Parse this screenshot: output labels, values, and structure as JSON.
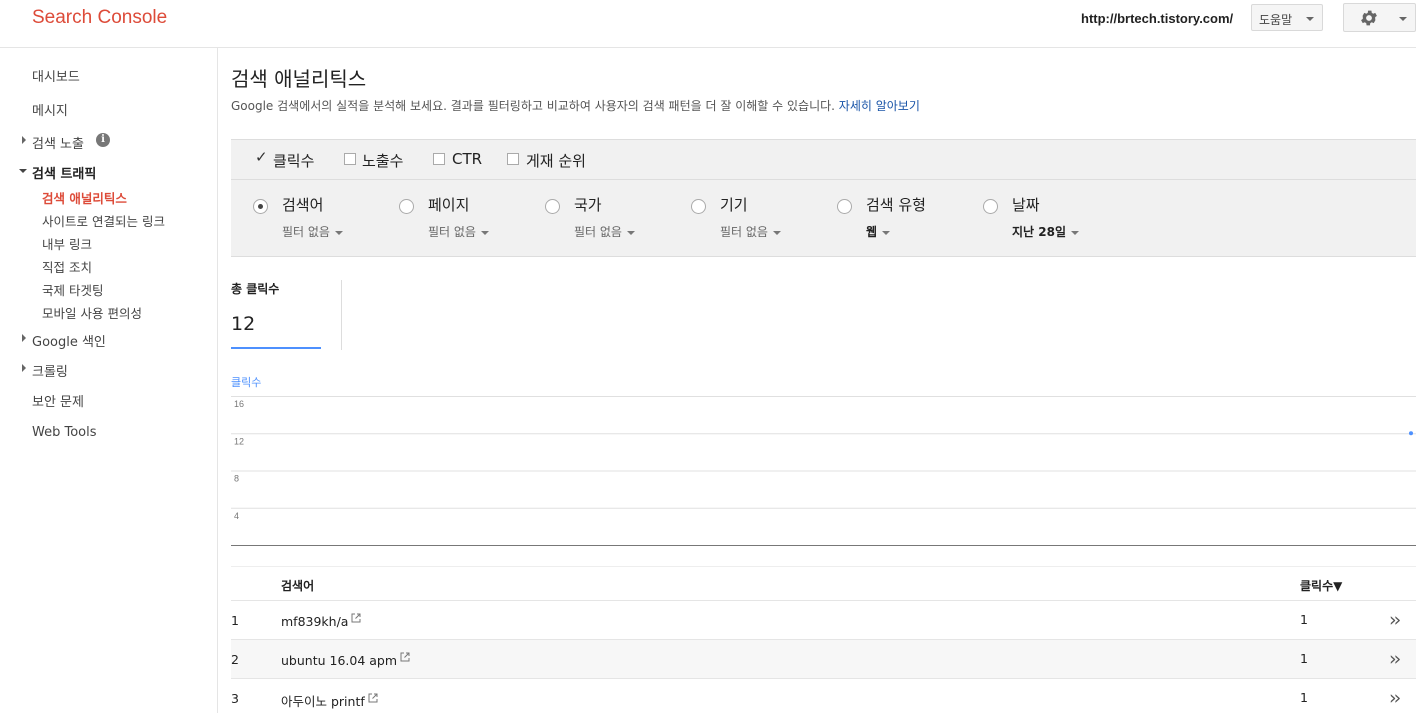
{
  "header": {
    "logo": "Search Console",
    "site_url": "http://brtech.tistory.com/",
    "help_label": "도움말",
    "settings_icon": "gear-icon"
  },
  "sidebar": {
    "dashboard": "대시보드",
    "messages": "메시지",
    "search_appearance": "검색 노출",
    "search_traffic": "검색 트래픽",
    "sub_items": [
      "검색 애널리틱스",
      "사이트로 연결되는 링크",
      "내부 링크",
      "직접 조치",
      "국제 타겟팅",
      "모바일 사용 편의성"
    ],
    "google_index": "Google 색인",
    "crawl": "크롤링",
    "security": "보안 문제",
    "web_tools": "Web Tools"
  },
  "main": {
    "title": "검색 애널리틱스",
    "description": "Google 검색에서의 실적을 분석해 보세요. 결과를 필터링하고 비교하여 사용자의 검색 패턴을 더 잘 이해할 수 있습니다.",
    "learn_more": "자세히 알아보기"
  },
  "metrics": [
    {
      "label": "클릭수",
      "checked": true
    },
    {
      "label": "노출수",
      "checked": false
    },
    {
      "label": "CTR",
      "checked": false
    },
    {
      "label": "게재 순위",
      "checked": false
    }
  ],
  "groups": [
    {
      "label": "검색어",
      "filter": "필터 없음",
      "selected": true
    },
    {
      "label": "페이지",
      "filter": "필터 없음",
      "selected": false
    },
    {
      "label": "국가",
      "filter": "필터 없음",
      "selected": false
    },
    {
      "label": "기기",
      "filter": "필터 없음",
      "selected": false
    },
    {
      "label": "검색 유형",
      "filter": "웹",
      "selected": false
    },
    {
      "label": "날짜",
      "filter": "지난 28일",
      "selected": false
    }
  ],
  "totals": {
    "label": "총 클릭수",
    "value": "12"
  },
  "chart_data": {
    "type": "line",
    "series": [
      {
        "name": "클릭수",
        "values": [
          12
        ]
      }
    ],
    "y_ticks": [
      "16",
      "12",
      "8",
      "4"
    ],
    "ylim": [
      0,
      16
    ],
    "grid": true,
    "colors": {
      "series": "#4d90fe"
    }
  },
  "table": {
    "headers": {
      "query": "검색어",
      "clicks": "클릭수▼"
    },
    "rows": [
      {
        "index": "1",
        "query": "mf839kh/a",
        "clicks": "1"
      },
      {
        "index": "2",
        "query": "ubuntu 16.04 apm",
        "clicks": "1"
      },
      {
        "index": "3",
        "query": "아두이노 printf",
        "clicks": "1"
      }
    ]
  }
}
